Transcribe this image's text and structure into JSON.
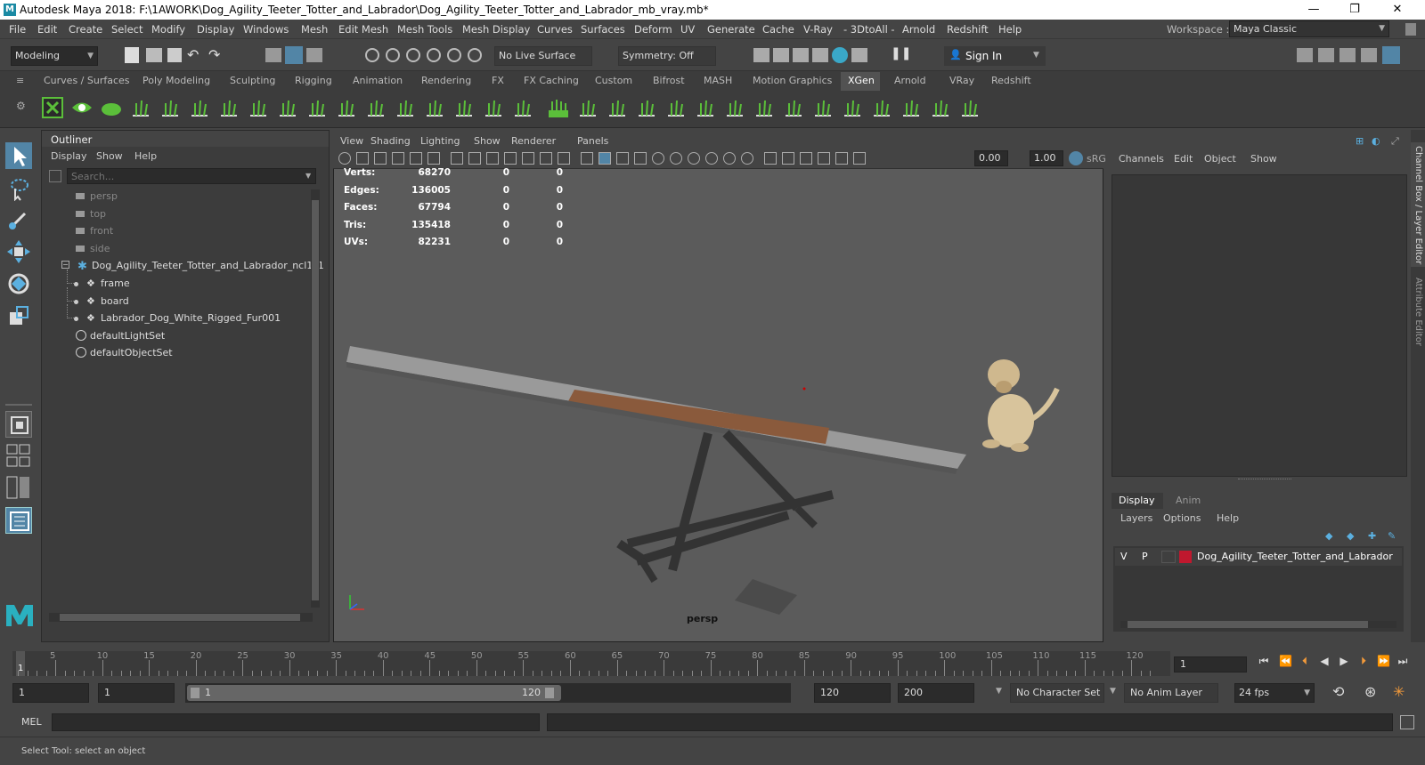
{
  "window": {
    "title": "Autodesk Maya 2018: F:\\1AWORK\\Dog_Agility_Teeter_Totter_and_Labrador\\Dog_Agility_Teeter_Totter_and_Labrador_mb_vray.mb*",
    "minimize": "—",
    "maximize": "❐",
    "close": "✕"
  },
  "menu": [
    "File",
    "Edit",
    "Create",
    "Select",
    "Modify",
    "Display",
    "Windows",
    "Mesh",
    "Edit Mesh",
    "Mesh Tools",
    "Mesh Display",
    "Curves",
    "Surfaces",
    "Deform",
    "UV",
    "Generate",
    "Cache",
    "V-Ray",
    "- 3DtoAll -",
    "Arnold",
    "Redshift",
    "Help"
  ],
  "workspace": {
    "label": "Workspace :",
    "value": "Maya Classic"
  },
  "toolbar": {
    "mode": "Modeling",
    "live_surface": "No Live Surface",
    "symmetry": "Symmetry: Off",
    "sign_in": "Sign In"
  },
  "shelf_tabs": [
    "Curves / Surfaces",
    "Poly Modeling",
    "Sculpting",
    "Rigging",
    "Animation",
    "Rendering",
    "FX",
    "FX Caching",
    "Custom",
    "Bifrost",
    "MASH",
    "Motion Graphics",
    "XGen",
    "Arnold",
    "VRay",
    "Redshift"
  ],
  "active_tab": "XGen",
  "outliner": {
    "title": "Outliner",
    "menu": [
      "Display",
      "Show",
      "Help"
    ],
    "search_placeholder": "Search...",
    "items": [
      {
        "label": "persp",
        "dim": true,
        "indent": 0
      },
      {
        "label": "top",
        "dim": true,
        "indent": 0
      },
      {
        "label": "front",
        "dim": true,
        "indent": 0
      },
      {
        "label": "side",
        "dim": true,
        "indent": 0
      },
      {
        "label": "Dog_Agility_Teeter_Totter_and_Labrador_ncl1_1",
        "dim": false,
        "indent": 0
      },
      {
        "label": "frame",
        "dim": false,
        "indent": 1
      },
      {
        "label": "board",
        "dim": false,
        "indent": 1
      },
      {
        "label": "Labrador_Dog_White_Rigged_Fur001",
        "dim": false,
        "indent": 1
      },
      {
        "label": "defaultLightSet",
        "dim": false,
        "indent": 0
      },
      {
        "label": "defaultObjectSet",
        "dim": false,
        "indent": 0
      }
    ]
  },
  "viewport": {
    "menu": [
      "View",
      "Shading",
      "Lighting",
      "Show",
      "Renderer",
      "Panels"
    ],
    "field1": "0.00",
    "field2": "1.00",
    "colorspace": "sRG",
    "camera": "persp",
    "stats": [
      {
        "label": "Verts:",
        "v1": "68270",
        "v2": "0",
        "v3": "0"
      },
      {
        "label": "Edges:",
        "v1": "136005",
        "v2": "0",
        "v3": "0"
      },
      {
        "label": "Faces:",
        "v1": "67794",
        "v2": "0",
        "v3": "0"
      },
      {
        "label": "Tris:",
        "v1": "135418",
        "v2": "0",
        "v3": "0"
      },
      {
        "label": "UVs:",
        "v1": "82231",
        "v2": "0",
        "v3": "0"
      }
    ]
  },
  "channel_box": {
    "menu": [
      "Channels",
      "Edit",
      "Object",
      "Show"
    ]
  },
  "layers": {
    "tabs": [
      "Display",
      "Anim"
    ],
    "menu": [
      "Layers",
      "Options",
      "Help"
    ],
    "v": "V",
    "p": "P",
    "layer_name": "Dog_Agility_Teeter_Totter_and_Labrador",
    "layer_color": "#c0182e"
  },
  "side_tabs": [
    "Channel Box / Layer Editor",
    "Attribute Editor"
  ],
  "timeline": {
    "ticks": [
      "5",
      "10",
      "15",
      "20",
      "25",
      "30",
      "35",
      "40",
      "45",
      "50",
      "55",
      "60",
      "65",
      "70",
      "75",
      "80",
      "85",
      "90",
      "95",
      "100",
      "105",
      "110",
      "115",
      "120"
    ],
    "current_frame_marker": "1",
    "current_frame": "1"
  },
  "range": {
    "start": "1",
    "playback_start": "1",
    "slider_start": "1",
    "slider_end": "120",
    "playback_end": "120",
    "end": "200",
    "character_set": "No Character Set",
    "anim_layer": "No Anim Layer",
    "fps": "24 fps"
  },
  "mel": {
    "label": "MEL"
  },
  "status": {
    "text": "Select Tool: select an object"
  },
  "colors": {
    "accent": "#5285a6",
    "shelf_green": "#5bbf3a"
  }
}
